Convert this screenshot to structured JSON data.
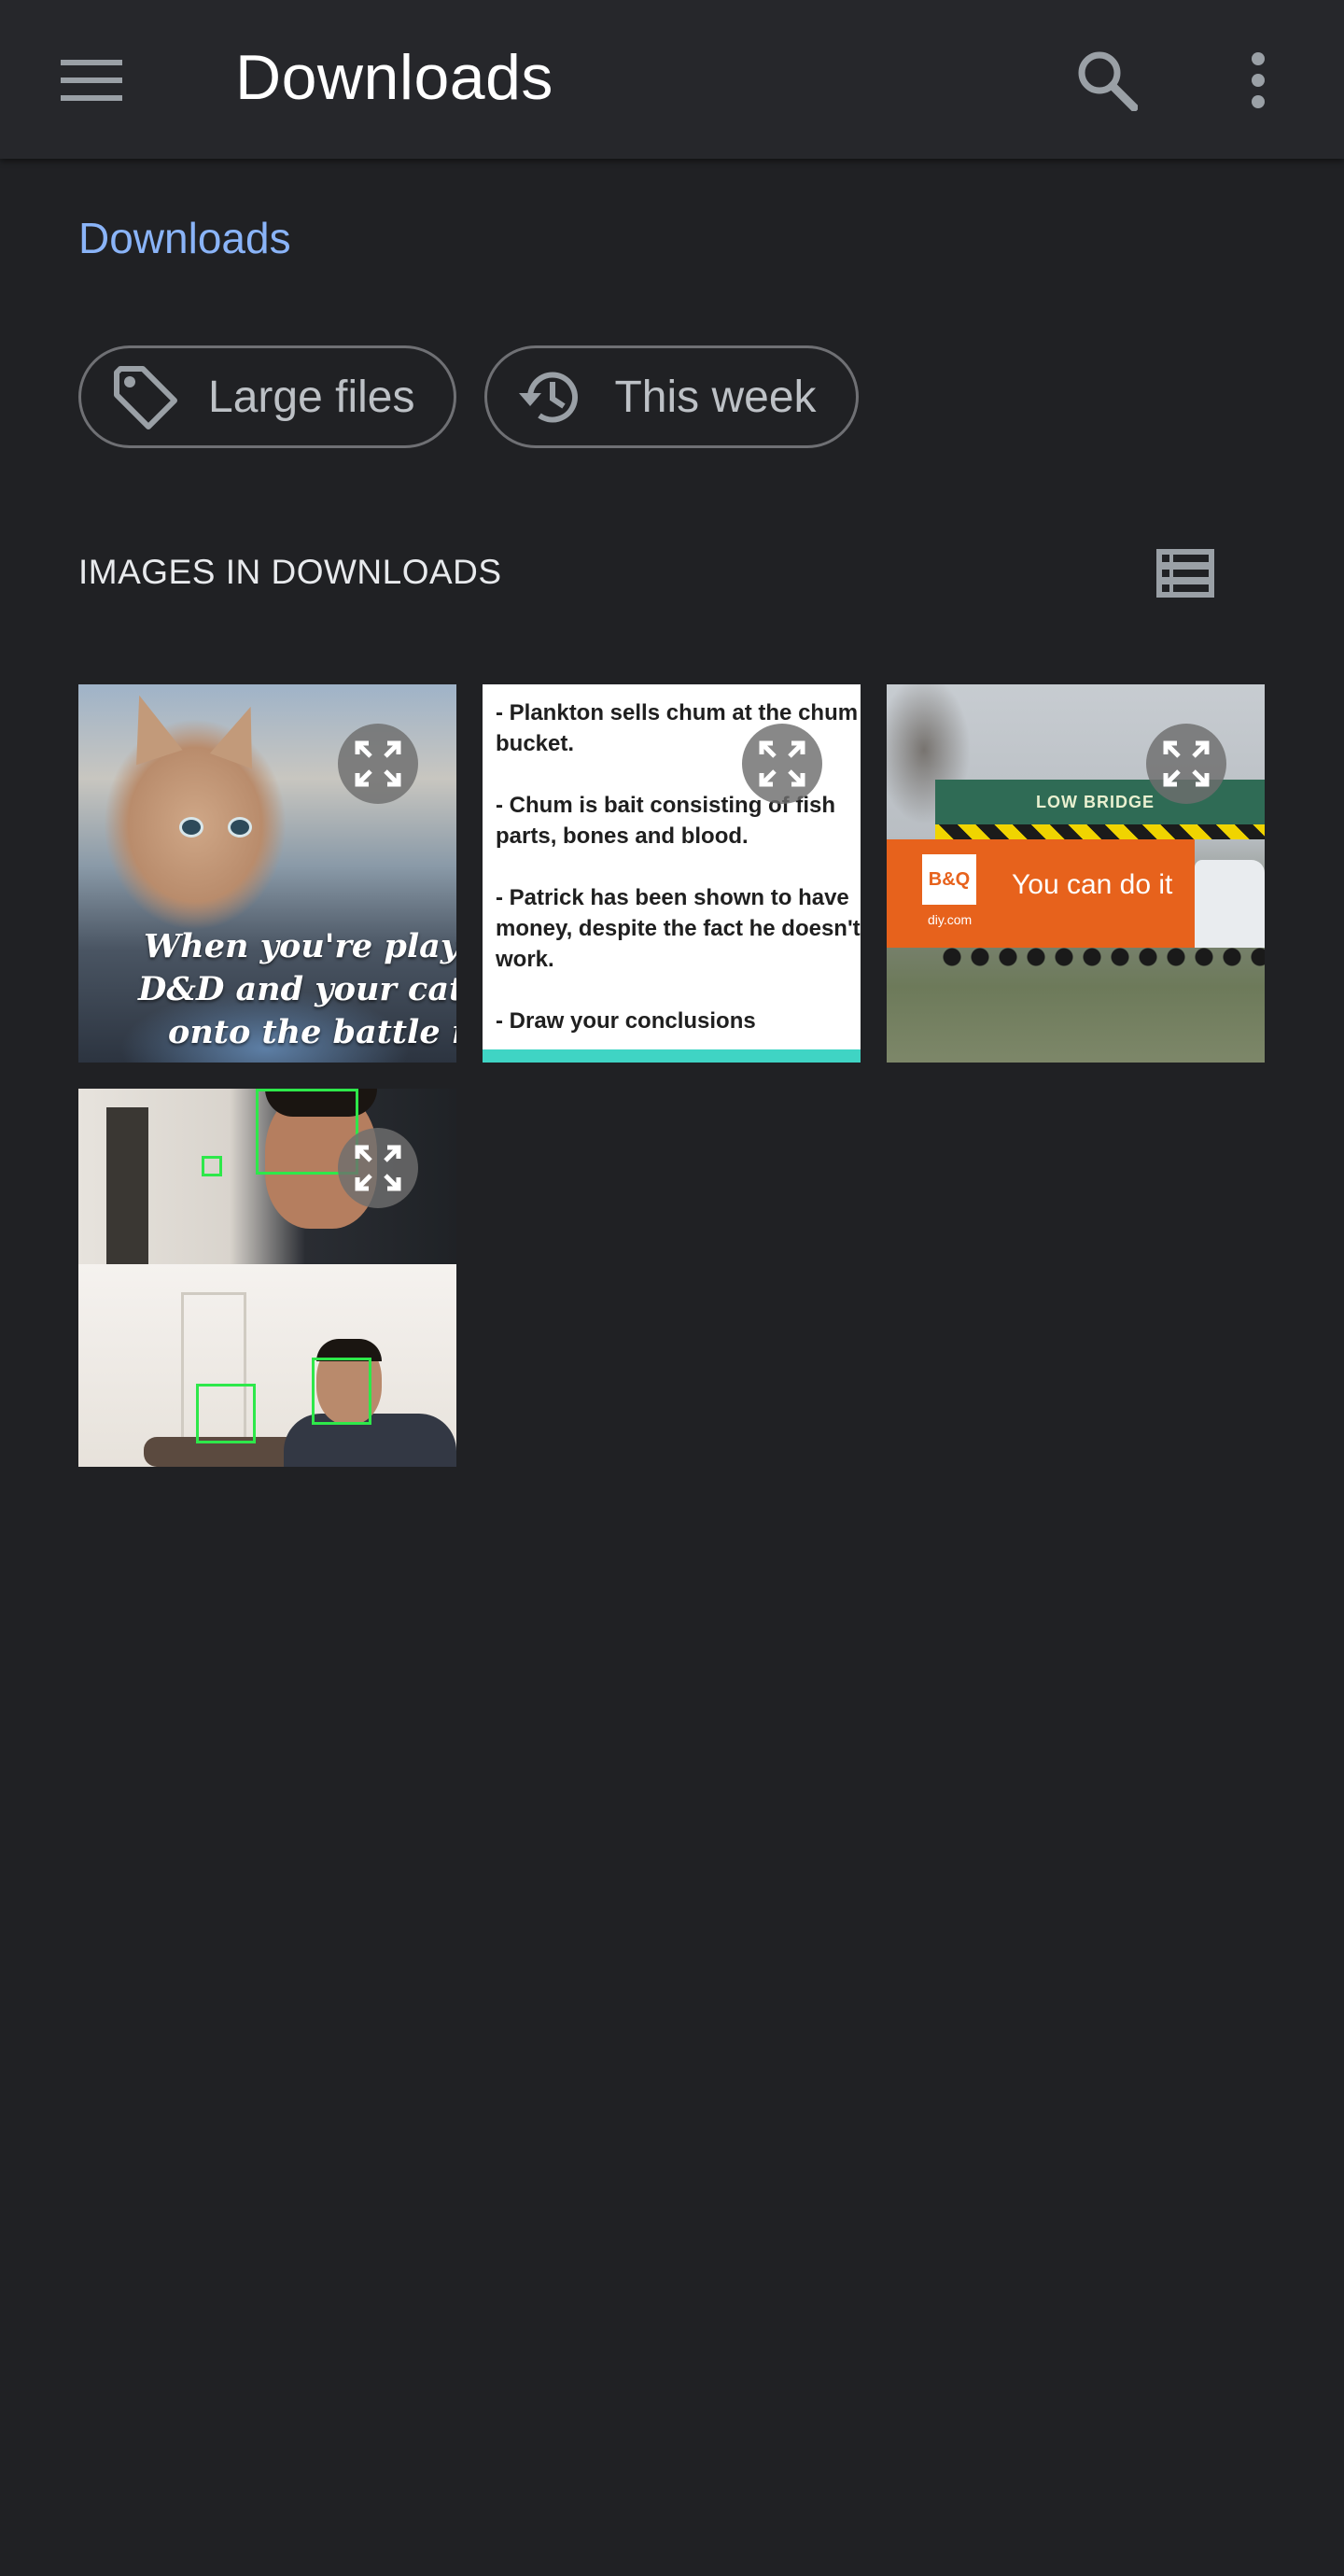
{
  "appbar": {
    "title": "Downloads",
    "icons": {
      "menu": "menu-icon",
      "search": "search-icon",
      "more": "more-vert-icon"
    }
  },
  "breadcrumb": {
    "label": "Downloads"
  },
  "chips": [
    {
      "label": "Large files",
      "icon": "tag-icon"
    },
    {
      "label": "This week",
      "icon": "history-icon"
    }
  ],
  "section": {
    "title": "IMAGES IN DOWNLOADS",
    "view_icon": "list-view-icon"
  },
  "tiles": [
    {
      "caption_lines": [
        "When you're play",
        "D&D and your cat s",
        "onto the battle m"
      ]
    },
    {
      "lines": [
        "- Plankton sells chum at the chum bucket.",
        "- Chum is bait consisting of fish parts, bones and blood.",
        "- Patrick has been shown to have money, despite the fact he doesn't work.",
        "- Draw your conclusions"
      ]
    },
    {
      "bridge_text": "LOW BRIDGE",
      "logo_text": "B&Q",
      "logo_sub": "diy.com",
      "slogan": "You can do it"
    },
    {}
  ],
  "colors": {
    "background": "#202124",
    "appbar": "#26272b",
    "accent": "#8ab4f8",
    "chip_border": "#6f7074"
  }
}
